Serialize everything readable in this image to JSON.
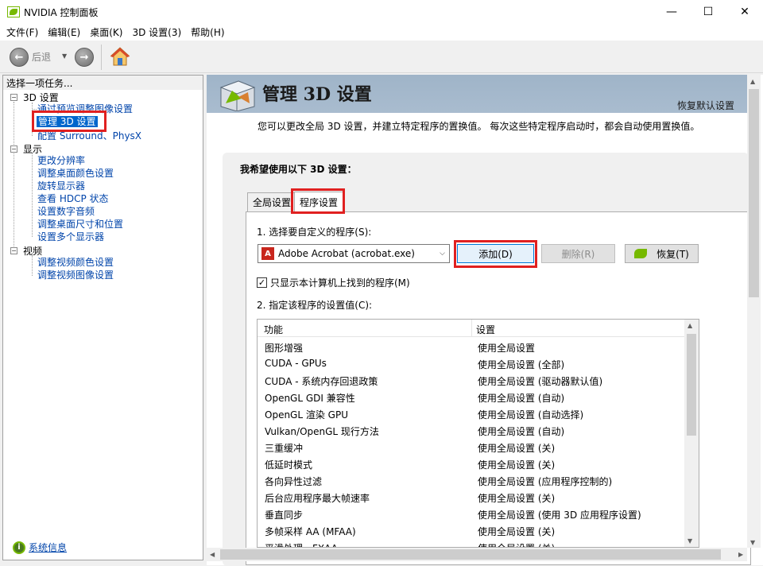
{
  "window": {
    "title": "NVIDIA 控制面板",
    "minimize": "—",
    "maximize": "☐",
    "close": "✕"
  },
  "menu": [
    "文件(F)",
    "编辑(E)",
    "桌面(K)",
    "3D 设置(3)",
    "帮助(H)"
  ],
  "toolbar": {
    "back_label": "后退",
    "dropdown": "▼",
    "back_icon": "←",
    "forward_icon": "→"
  },
  "left": {
    "header": "选择一项任务...",
    "groups": [
      {
        "label": "3D 设置",
        "items": [
          "通过预览调整图像设置",
          "管理 3D 设置",
          "配置 Surround、PhysX"
        ]
      },
      {
        "label": "显示",
        "items": [
          "更改分辨率",
          "调整桌面颜色设置",
          "旋转显示器",
          "查看 HDCP 状态",
          "设置数字音频",
          "调整桌面尺寸和位置",
          "设置多个显示器"
        ]
      },
      {
        "label": "视频",
        "items": [
          "调整视频颜色设置",
          "调整视频图像设置"
        ]
      }
    ],
    "sysinfo": "系统信息",
    "expander": "−"
  },
  "main": {
    "title": "管理 3D 设置",
    "restore_defaults": "恢复默认设置",
    "description": "您可以更改全局 3D 设置，并建立特定程序的置换值。 每次这些特定程序启动时，都会自动使用置换值。",
    "section_heading": "我希望使用以下 3D 设置：",
    "tabs": [
      "全局设置",
      "程序设置"
    ],
    "step1": "1. 选择要自定义的程序(S):",
    "program_selected": "Adobe Acrobat (acrobat.exe)",
    "add_button": "添加(D)",
    "remove_button": "删除(R)",
    "restore_button": "恢复(T)",
    "checkbox_label": "只显示本计算机上找到的程序(M)",
    "checkbox_checked": "✓",
    "step2": "2. 指定该程序的设置值(C):",
    "table": {
      "col_feature": "功能",
      "col_setting": "设置",
      "rows": [
        [
          "图形增强",
          "使用全局设置"
        ],
        [
          "CUDA - GPUs",
          "使用全局设置 (全部)"
        ],
        [
          "CUDA - 系统内存回退政策",
          "使用全局设置 (驱动器默认值)"
        ],
        [
          "OpenGL GDI 兼容性",
          "使用全局设置 (自动)"
        ],
        [
          "OpenGL 渲染 GPU",
          "使用全局设置 (自动选择)"
        ],
        [
          "Vulkan/OpenGL 现行方法",
          "使用全局设置 (自动)"
        ],
        [
          "三重缓冲",
          "使用全局设置 (关)"
        ],
        [
          "低延时模式",
          "使用全局设置 (关)"
        ],
        [
          "各向异性过滤",
          "使用全局设置 (应用程序控制的)"
        ],
        [
          "后台应用程序最大帧速率",
          "使用全局设置 (关)"
        ],
        [
          "垂直同步",
          "使用全局设置 (使用 3D 应用程序设置)"
        ],
        [
          "多帧采样 AA (MFAA)",
          "使用全局设置 (关)"
        ],
        [
          "平滑处理 - FXAA",
          "使用全局设置 (关)"
        ]
      ]
    }
  },
  "colors": {
    "highlight": "#e02020",
    "nvidia_green": "#76b900",
    "link": "#0044aa",
    "selection": "#0066cc"
  }
}
